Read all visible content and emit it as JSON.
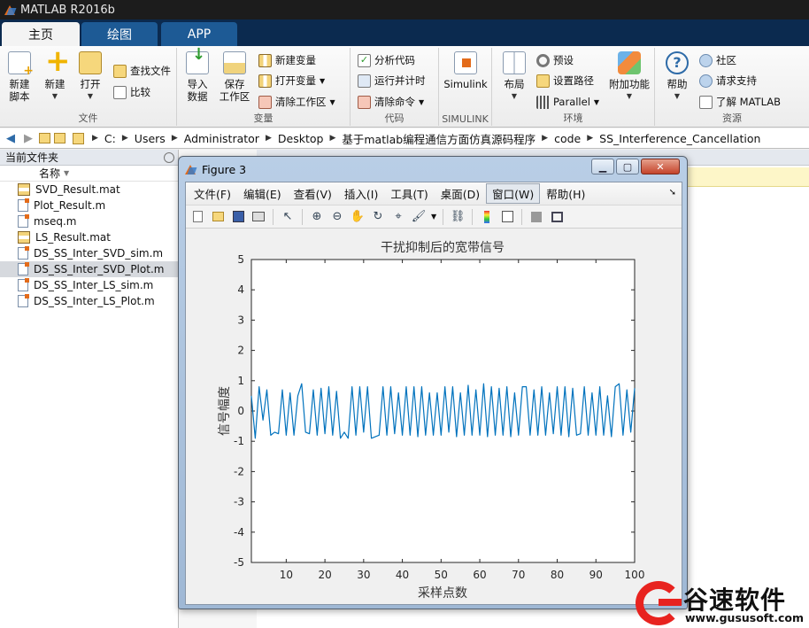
{
  "app": {
    "title": "MATLAB R2016b"
  },
  "tabs": [
    {
      "label": "主页",
      "active": true
    },
    {
      "label": "绘图",
      "active": false
    },
    {
      "label": "APP",
      "active": false
    }
  ],
  "ribbon": {
    "file": {
      "label": "文件",
      "new_script": "新建\n脚本",
      "new": "新建",
      "open": "打开",
      "find_files": "查找文件",
      "compare": "比较"
    },
    "variable": {
      "label": "变量",
      "import": "导入\n数据",
      "save": "保存\n工作区",
      "new_var": "新建变量",
      "open_var": "打开变量",
      "clear_ws": "清除工作区"
    },
    "code": {
      "label": "代码",
      "analyze": "分析代码",
      "run_time": "运行并计时",
      "clear_cmd": "清除命令"
    },
    "simulink": {
      "label": "SIMULINK",
      "button": "Simulink"
    },
    "env": {
      "label": "环境",
      "layout": "布局",
      "prefs": "预设",
      "set_path": "设置路径",
      "parallel": "Parallel",
      "addons": "附加功能"
    },
    "resources": {
      "label": "资源",
      "help": "帮助",
      "community": "社区",
      "support": "请求支持",
      "learn": "了解 MATLAB"
    }
  },
  "address": {
    "crumbs": [
      "C:",
      "Users",
      "Administrator",
      "Desktop",
      "基于matlab编程通信方面仿真源码程序",
      "code",
      "SS_Interference_Cancellation"
    ]
  },
  "filepanel": {
    "title": "当前文件夹",
    "column": "名称",
    "files": [
      {
        "name": "SVD_Result.mat",
        "type": "mat",
        "selected": false
      },
      {
        "name": "Plot_Result.m",
        "type": "m",
        "selected": false
      },
      {
        "name": "mseq.m",
        "type": "m",
        "selected": false
      },
      {
        "name": "LS_Result.mat",
        "type": "mat",
        "selected": false
      },
      {
        "name": "DS_SS_Inter_SVD_sim.m",
        "type": "m",
        "selected": false
      },
      {
        "name": "DS_SS_Inter_SVD_Plot.m",
        "type": "m",
        "selected": true
      },
      {
        "name": "DS_SS_Inter_LS_sim.m",
        "type": "m",
        "selected": false
      },
      {
        "name": "DS_SS_Inter_LS_Plot.m",
        "type": "m",
        "selected": false
      }
    ]
  },
  "figure": {
    "title": "Figure 3",
    "menus": [
      {
        "label": "文件(F)",
        "active": false
      },
      {
        "label": "编辑(E)",
        "active": false
      },
      {
        "label": "查看(V)",
        "active": false
      },
      {
        "label": "插入(I)",
        "active": false
      },
      {
        "label": "工具(T)",
        "active": false
      },
      {
        "label": "桌面(D)",
        "active": false
      },
      {
        "label": "窗口(W)",
        "active": true
      },
      {
        "label": "帮助(H)",
        "active": false
      }
    ]
  },
  "chart_data": {
    "type": "line",
    "title": "干扰抑制后的宽带信号",
    "xlabel": "采样点数",
    "ylabel": "信号幅度",
    "xlim": [
      1,
      100
    ],
    "ylim": [
      -5,
      5
    ],
    "xticks": [
      10,
      20,
      30,
      40,
      50,
      60,
      70,
      80,
      90,
      100
    ],
    "yticks": [
      5,
      4,
      3,
      2,
      1,
      0,
      -1,
      -2,
      -3,
      -4,
      -5
    ],
    "grid": false,
    "line_color": "#0072bd",
    "series": [
      {
        "x": [
          1,
          2,
          3,
          4,
          5,
          6,
          7,
          8,
          9,
          10,
          11,
          12,
          13,
          14,
          15,
          16,
          17,
          18,
          19,
          20,
          21,
          22,
          23,
          24,
          25,
          26,
          27,
          28,
          29,
          30,
          31,
          32,
          33,
          34,
          35,
          36,
          37,
          38,
          39,
          40,
          41,
          42,
          43,
          44,
          45,
          46,
          47,
          48,
          49,
          50,
          51,
          52,
          53,
          54,
          55,
          56,
          57,
          58,
          59,
          60,
          61,
          62,
          63,
          64,
          65,
          66,
          67,
          68,
          69,
          70,
          71,
          72,
          73,
          74,
          75,
          76,
          77,
          78,
          79,
          80,
          81,
          82,
          83,
          84,
          85,
          86,
          87,
          88,
          89,
          90,
          91,
          92,
          93,
          94,
          95,
          96,
          97,
          98,
          99,
          100
        ],
        "y": [
          0.5,
          -0.9,
          0.8,
          -0.3,
          0.7,
          -0.8,
          -0.7,
          -0.75,
          0.7,
          -0.8,
          0.6,
          -0.8,
          0.5,
          0.9,
          -0.7,
          -0.75,
          0.7,
          -0.8,
          0.75,
          -0.75,
          0.8,
          -0.8,
          0.65,
          -0.9,
          -0.7,
          -0.9,
          0.8,
          -0.8,
          0.8,
          -0.7,
          0.8,
          -0.9,
          -0.85,
          -0.8,
          0.8,
          -0.8,
          0.8,
          -0.75,
          0.6,
          -0.8,
          0.8,
          -0.8,
          0.8,
          -0.85,
          0.8,
          -0.8,
          0.6,
          -0.8,
          0.6,
          -0.8,
          0.8,
          -0.7,
          0.8,
          -0.85,
          0.6,
          -0.8,
          0.85,
          -0.8,
          0.7,
          -0.8,
          0.9,
          -0.85,
          0.8,
          -0.8,
          0.75,
          -0.8,
          0.8,
          -0.85,
          0.6,
          -0.8,
          0.8,
          0.8,
          -0.8,
          0.7,
          -0.8,
          0.8,
          -0.8,
          0.6,
          -0.75,
          0.8,
          -0.8,
          0.8,
          -0.85,
          0.75,
          -0.8,
          -0.75,
          0.8,
          -0.8,
          0.6,
          -0.8,
          0.8,
          -0.8,
          0.5,
          -0.85,
          0.8,
          0.9,
          -0.8,
          0.7,
          -0.7,
          0.75
        ]
      }
    ]
  },
  "watermark": {
    "name": "谷速软件",
    "url": "www.gususoft.com"
  }
}
